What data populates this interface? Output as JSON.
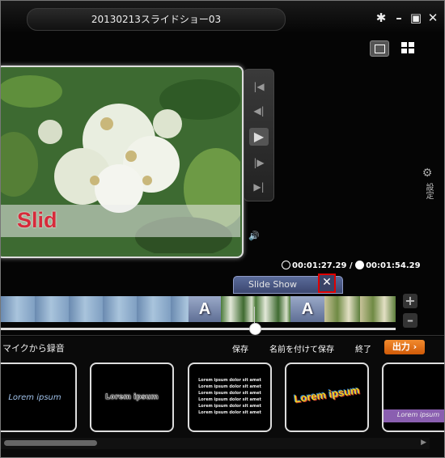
{
  "window": {
    "title": "20130213スライドショー03",
    "controls": {
      "settings": "✱",
      "minimize": "–",
      "maximize": "▣",
      "close": "✕"
    }
  },
  "preview": {
    "overlay_text": "Slid"
  },
  "transport": {
    "to_start": "|◀",
    "prev_frame": "◀|",
    "play": "▶",
    "next_frame": "|▶",
    "to_end": "▶|"
  },
  "volume_icon": "🔊",
  "settings_label": "設定",
  "time": {
    "current": "00:01:27.29",
    "separator": "/",
    "total": "00:01:54.29"
  },
  "clip": {
    "label": "Slide Show",
    "close": "✕"
  },
  "timeline": {
    "title_clip_letter": "A",
    "zoom_in": "+",
    "zoom_out": "–",
    "playhead_fraction": 0.64
  },
  "bottom_menu": {
    "record_mic": "マイクから録音",
    "save": "保存",
    "save_as": "名前を付けて保存",
    "exit": "終了",
    "output": "出力 ›"
  },
  "templates": [
    {
      "text": "Lorem ipsum",
      "style": "blue-italic"
    },
    {
      "text": "Lorem ipsum",
      "style": "outlined"
    },
    {
      "lines": [
        "Lorem ipsum dolor sit amet",
        "Lorem ipsum dolor sit amet",
        "Lorem ipsum dolor sit amet",
        "Lorem ipsum dolor sit amet",
        "Lorem ipsum dolor sit amet",
        "Lorem ipsum dolor sit amet"
      ],
      "style": "list"
    },
    {
      "text": "Lorem ipsum",
      "style": "rainbow"
    },
    {
      "text": "Lorem ipsum",
      "style": "purple-band"
    }
  ],
  "colors": {
    "accent_orange": "#e8711b",
    "highlight_red": "#e00000",
    "clip_label_blue": "#4a5680",
    "overlay_text_red": "#d72a3a"
  }
}
